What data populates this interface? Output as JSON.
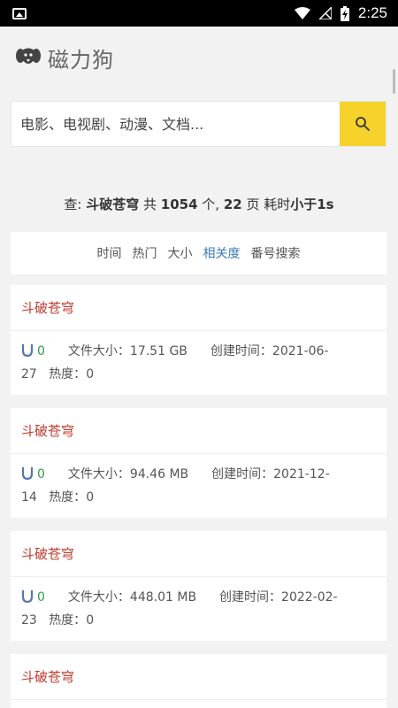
{
  "status_bar": {
    "time": "2:25"
  },
  "header": {
    "title": "磁力狗"
  },
  "search": {
    "placeholder": "电影、电视剧、动漫、文档..."
  },
  "summary": {
    "prefix": "查: ",
    "keyword": "斗破苍穹",
    "total_label": " 共 ",
    "total": "1054",
    "unit": " 个, ",
    "pages": "22",
    "pages_label": " 页 耗时",
    "time": "小于1s"
  },
  "sort_tabs": [
    {
      "label": "时间"
    },
    {
      "label": "热门"
    },
    {
      "label": "大小"
    },
    {
      "label": "相关度"
    },
    {
      "label": "番号搜索"
    }
  ],
  "labels": {
    "size": "文件大小：",
    "created": "创建时间：",
    "heat": "热度："
  },
  "results": [
    {
      "title": "斗破苍穹",
      "count": "0",
      "size": "17.51 GB",
      "created_a": "2021-06-",
      "created_b": "27",
      "heat": "0"
    },
    {
      "title": "斗破苍穹",
      "count": "0",
      "size": "94.46 MB",
      "created_a": "2021-12-",
      "created_b": "14",
      "heat": "0"
    },
    {
      "title": "斗破苍穹",
      "count": "0",
      "size": "448.01 MB",
      "created_a": "2022-02-",
      "created_b": "23",
      "heat": "0"
    },
    {
      "title": "斗破苍穹"
    }
  ],
  "colors": {
    "accent": "#f6d22b",
    "title_red": "#c0392b",
    "count_green": "#2e9a4a",
    "active_tab": "#3a7ab8"
  }
}
